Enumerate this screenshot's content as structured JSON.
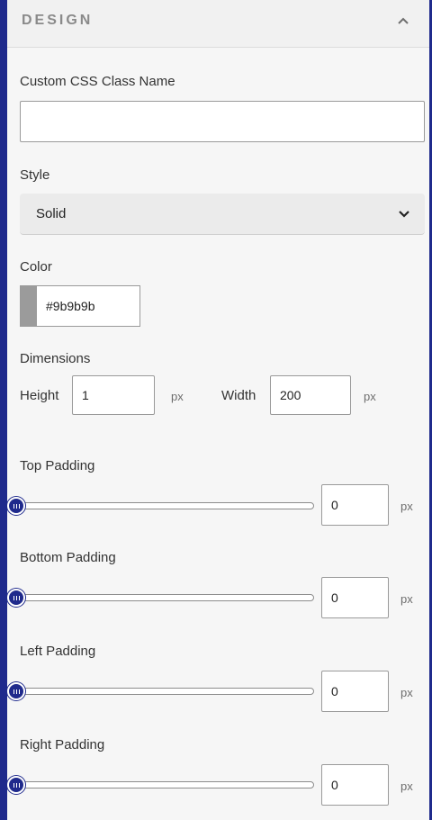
{
  "header": {
    "title": "DESIGN",
    "toggle_icon": "chevron-up-icon"
  },
  "css_class": {
    "label": "Custom CSS Class Name",
    "value": ""
  },
  "style": {
    "label": "Style",
    "value": "Solid",
    "icon": "chevron-down-icon"
  },
  "color": {
    "label": "Color",
    "value": "#9b9b9b",
    "swatch": "#9b9b9b"
  },
  "dimensions": {
    "label": "Dimensions",
    "height_label": "Height",
    "height_value": "1",
    "height_unit": "px",
    "width_label": "Width",
    "width_value": "200",
    "width_unit": "px"
  },
  "paddings": [
    {
      "label": "Top Padding",
      "value": "0",
      "unit": "px"
    },
    {
      "label": "Bottom Padding",
      "value": "0",
      "unit": "px"
    },
    {
      "label": "Left Padding",
      "value": "0",
      "unit": "px"
    },
    {
      "label": "Right Padding",
      "value": "0",
      "unit": "px"
    }
  ],
  "colors": {
    "accent": "#1f2a8c"
  }
}
